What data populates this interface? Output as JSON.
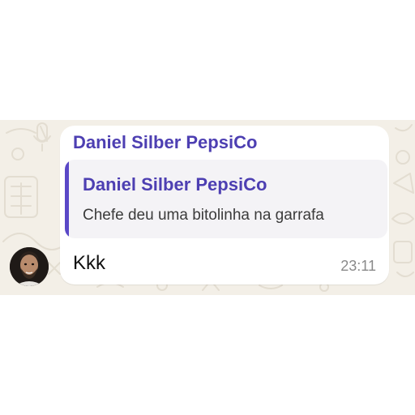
{
  "chat": {
    "sender_name": "Daniel Silber PepsiCo",
    "quoted": {
      "sender_name": "Daniel Silber PepsiCo",
      "text": "Chefe deu uma bitolinha na garrafa"
    },
    "message_text": "Kkk",
    "timestamp": "23:11"
  },
  "colors": {
    "sender_name": "#4d3fb2",
    "quote_accent": "#5a48c7",
    "wallpaper": "#f3efe7",
    "bubble": "#ffffff"
  },
  "icons": {
    "avatar": "avatar-photo"
  }
}
